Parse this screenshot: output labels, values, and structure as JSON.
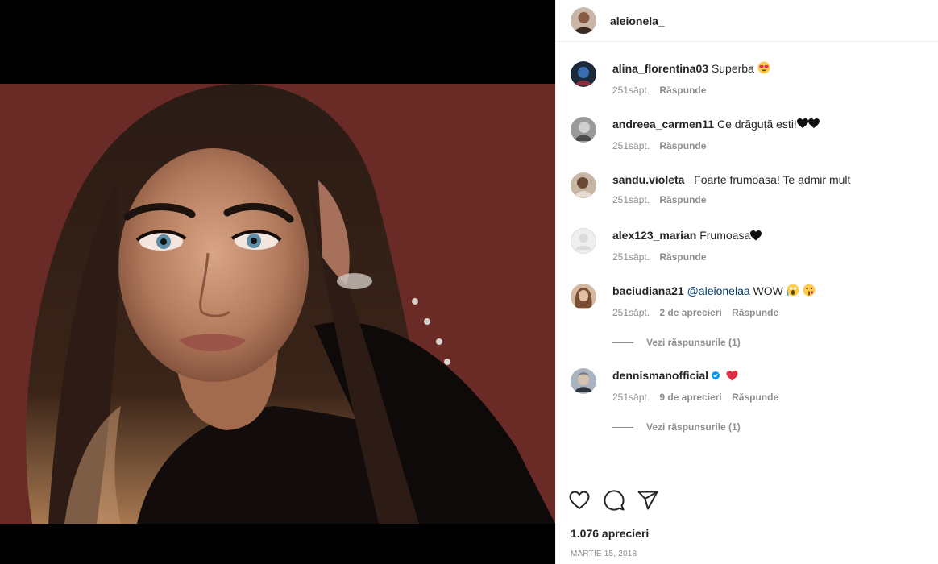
{
  "post": {
    "author": "aleionela_",
    "likes": "1.076 aprecieri",
    "date": "MARTIE 15, 2018"
  },
  "comments": [
    {
      "user": "alina_florentina03",
      "text": "Superba",
      "emoji": "heart-eyes",
      "time": "251săpt.",
      "likes": "",
      "reply": "Răspunde"
    },
    {
      "user": "andreea_carmen11",
      "text": "Ce drăguță esti!",
      "emoji": "black-hearts",
      "time": "251săpt.",
      "likes": "",
      "reply": "Răspunde"
    },
    {
      "user": "sandu.violeta_",
      "text": "Foarte frumoasa! Te admir mult",
      "time": "251săpt.",
      "likes": "",
      "reply": "Răspunde"
    },
    {
      "user": "alex123_marian",
      "text": "Frumoasa",
      "emoji": "black-heart",
      "time": "251săpt.",
      "likes": "",
      "reply": "Răspunde"
    },
    {
      "user": "baciudiana21",
      "mention": "@aleionelaa",
      "text": "WOW",
      "emoji": "scream-kiss",
      "time": "251săpt.",
      "likes": "2 de aprecieri",
      "reply": "Răspunde",
      "view_replies": "Vezi răspunsurile (1)"
    },
    {
      "user": "dennismanofficial",
      "text": "",
      "emoji": "red-heart",
      "verified": true,
      "time": "251săpt.",
      "likes": "9 de aprecieri",
      "reply": "Răspunde",
      "view_replies": "Vezi răspunsurile (1)"
    }
  ],
  "icons": {
    "like": "heart-outline-icon",
    "comment": "speech-bubble-icon",
    "share": "paper-plane-icon"
  },
  "colors": {
    "link": "#00376b",
    "secondary": "#8e8e8e",
    "verified": "#0095f6",
    "heart": "#ed4956"
  }
}
